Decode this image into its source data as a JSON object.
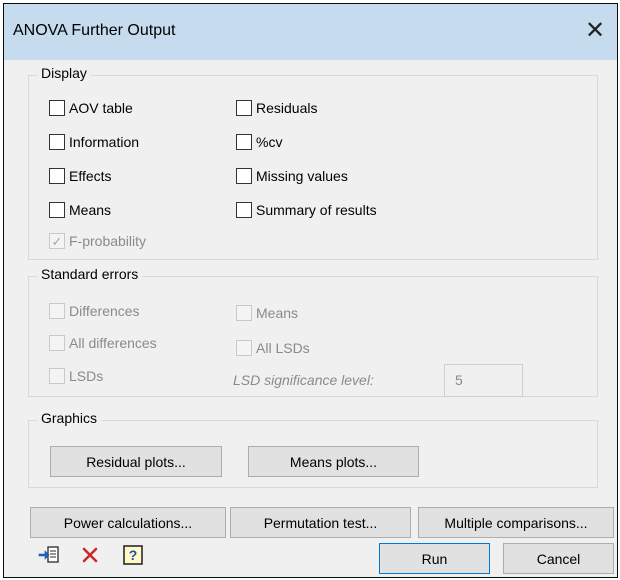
{
  "window": {
    "title": "ANOVA Further Output"
  },
  "display": {
    "label": "Display",
    "left": [
      {
        "label": "AOV table",
        "checked": false,
        "enabled": true
      },
      {
        "label": "Information",
        "checked": false,
        "enabled": true
      },
      {
        "label": "Effects",
        "checked": false,
        "enabled": true
      },
      {
        "label": "Means",
        "checked": false,
        "enabled": true
      },
      {
        "label": "F-probability",
        "checked": true,
        "enabled": false
      }
    ],
    "right": [
      {
        "label": "Residuals",
        "checked": false,
        "enabled": true
      },
      {
        "label": "%cv",
        "checked": false,
        "enabled": true
      },
      {
        "label": "Missing values",
        "checked": false,
        "enabled": true
      },
      {
        "label": "Summary of results",
        "checked": false,
        "enabled": true
      }
    ]
  },
  "standard_errors": {
    "label": "Standard errors",
    "differences": "Differences",
    "all_differences": "All differences",
    "lsds": "LSDs",
    "means": "Means",
    "all_lsds": "All LSDs",
    "lsd_level_label": "LSD significance level:",
    "lsd_level_value": "5"
  },
  "graphics": {
    "label": "Graphics",
    "residual_plots": "Residual plots...",
    "means_plots": "Means plots..."
  },
  "actions": {
    "power": "Power calculations...",
    "permutation": "Permutation test...",
    "multiple": "Multiple comparisons...",
    "run": "Run",
    "cancel": "Cancel"
  }
}
